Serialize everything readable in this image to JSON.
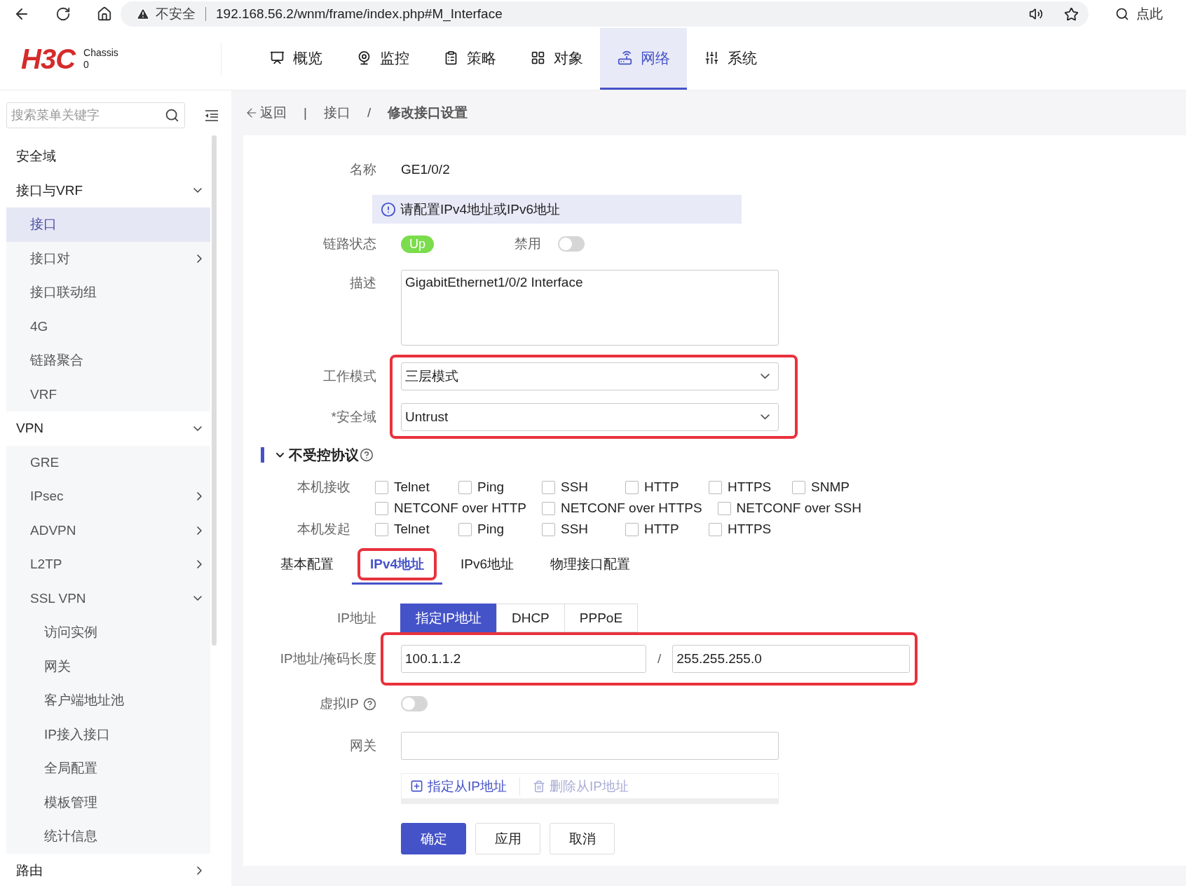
{
  "browser": {
    "security": "不安全",
    "url": "192.168.56.2/wnm/frame/index.php#M_Interface",
    "side_text": "点此"
  },
  "header": {
    "logo": "H3C",
    "chassis_label": "Chassis",
    "chassis_value": "0",
    "nav": [
      {
        "label": "概览",
        "selected": false
      },
      {
        "label": "监控",
        "selected": false
      },
      {
        "label": "策略",
        "selected": false
      },
      {
        "label": "对象",
        "selected": false
      },
      {
        "label": "网络",
        "selected": true
      },
      {
        "label": "系统",
        "selected": false
      }
    ]
  },
  "sidebar": {
    "search_placeholder": "搜索菜单关键字",
    "items": [
      {
        "label": "安全域",
        "selected": false
      },
      {
        "label": "接口与VRF",
        "selected": false,
        "expanded": true,
        "children": [
          {
            "label": "接口",
            "selected": true
          },
          {
            "label": "接口对",
            "selected": false,
            "expanded": false
          },
          {
            "label": "接口联动组",
            "selected": false
          },
          {
            "label": "4G",
            "selected": false
          },
          {
            "label": "链路聚合",
            "selected": false
          },
          {
            "label": "VRF",
            "selected": false
          }
        ]
      },
      {
        "label": "VPN",
        "selected": false,
        "expanded": true,
        "children": [
          {
            "label": "GRE",
            "selected": false
          },
          {
            "label": "IPsec",
            "selected": false,
            "expanded": false
          },
          {
            "label": "ADVPN",
            "selected": false,
            "expanded": false
          },
          {
            "label": "L2TP",
            "selected": false,
            "expanded": false
          },
          {
            "label": "SSL VPN",
            "selected": false,
            "expanded": true,
            "children": [
              {
                "label": "访问实例",
                "selected": false
              },
              {
                "label": "网关",
                "selected": false
              },
              {
                "label": "客户端地址池",
                "selected": false
              },
              {
                "label": "IP接入接口",
                "selected": false
              },
              {
                "label": "全局配置",
                "selected": false
              },
              {
                "label": "模板管理",
                "selected": false
              },
              {
                "label": "统计信息",
                "selected": false
              }
            ]
          }
        ]
      },
      {
        "label": "路由",
        "selected": false,
        "expanded": false
      }
    ]
  },
  "breadcrumb": {
    "back": "返回",
    "separator": "|",
    "parent": "接口",
    "slash": "/",
    "current": "修改接口设置"
  },
  "form": {
    "name": {
      "label": "名称",
      "value": "GE1/0/2"
    },
    "notice": "请配置IPv4地址或IPv6地址",
    "link": {
      "label": "链路状态",
      "status": "Up",
      "up": true
    },
    "disable": {
      "label": "禁用",
      "on": false
    },
    "description": {
      "label": "描述",
      "value": "GigabitEthernet1/0/2 Interface"
    },
    "mode_group": {
      "highlighted": true,
      "fields": [
        {
          "label": "工作模式",
          "value": "三层模式"
        },
        {
          "label": "*安全域",
          "value": "Untrust"
        }
      ]
    },
    "protocols": {
      "title": "不受控协议",
      "expanded": true,
      "groups": [
        {
          "label": "本机接收",
          "options": [
            {
              "label": "Telnet",
              "checked": false
            },
            {
              "label": "Ping",
              "checked": false
            },
            {
              "label": "SSH",
              "checked": false
            },
            {
              "label": "HTTP",
              "checked": false
            },
            {
              "label": "HTTPS",
              "checked": false
            },
            {
              "label": "SNMP",
              "checked": false
            },
            {
              "label": "NETCONF over HTTP",
              "checked": false
            },
            {
              "label": "NETCONF over HTTPS",
              "checked": false
            },
            {
              "label": "NETCONF over SSH",
              "checked": false
            }
          ]
        },
        {
          "label": "本机发起",
          "options": [
            {
              "label": "Telnet",
              "checked": false
            },
            {
              "label": "Ping",
              "checked": false
            },
            {
              "label": "SSH",
              "checked": false
            },
            {
              "label": "HTTP",
              "checked": false
            },
            {
              "label": "HTTPS",
              "checked": false
            }
          ]
        }
      ]
    },
    "tabs": [
      {
        "label": "基本配置",
        "selected": false,
        "highlighted": false
      },
      {
        "label": "IPv4地址",
        "selected": true,
        "highlighted": true
      },
      {
        "label": "IPv6地址",
        "selected": false,
        "highlighted": false
      },
      {
        "label": "物理接口配置",
        "selected": false,
        "highlighted": false
      }
    ],
    "ipv4": {
      "address_label": "IP地址",
      "modes": [
        {
          "label": "指定IP地址",
          "selected": true
        },
        {
          "label": "DHCP",
          "selected": false
        },
        {
          "label": "PPPoE",
          "selected": false
        }
      ],
      "mask_label": "IP地址/掩码长度",
      "address": "100.1.1.2",
      "separator": "/",
      "mask": "255.255.255.0",
      "highlighted": true,
      "virtual_ip": {
        "label": "虚拟IP",
        "on": false
      },
      "gateway": {
        "label": "网关"
      },
      "secondary_actions": [
        {
          "label": "指定从IP地址",
          "kind": "add",
          "disabled": false
        },
        {
          "label": "删除从IP地址",
          "kind": "delete",
          "disabled": true
        }
      ]
    },
    "buttons": [
      {
        "label": "确定",
        "kind": "primary"
      },
      {
        "label": "应用",
        "kind": "default"
      },
      {
        "label": "取消",
        "kind": "default"
      }
    ]
  }
}
